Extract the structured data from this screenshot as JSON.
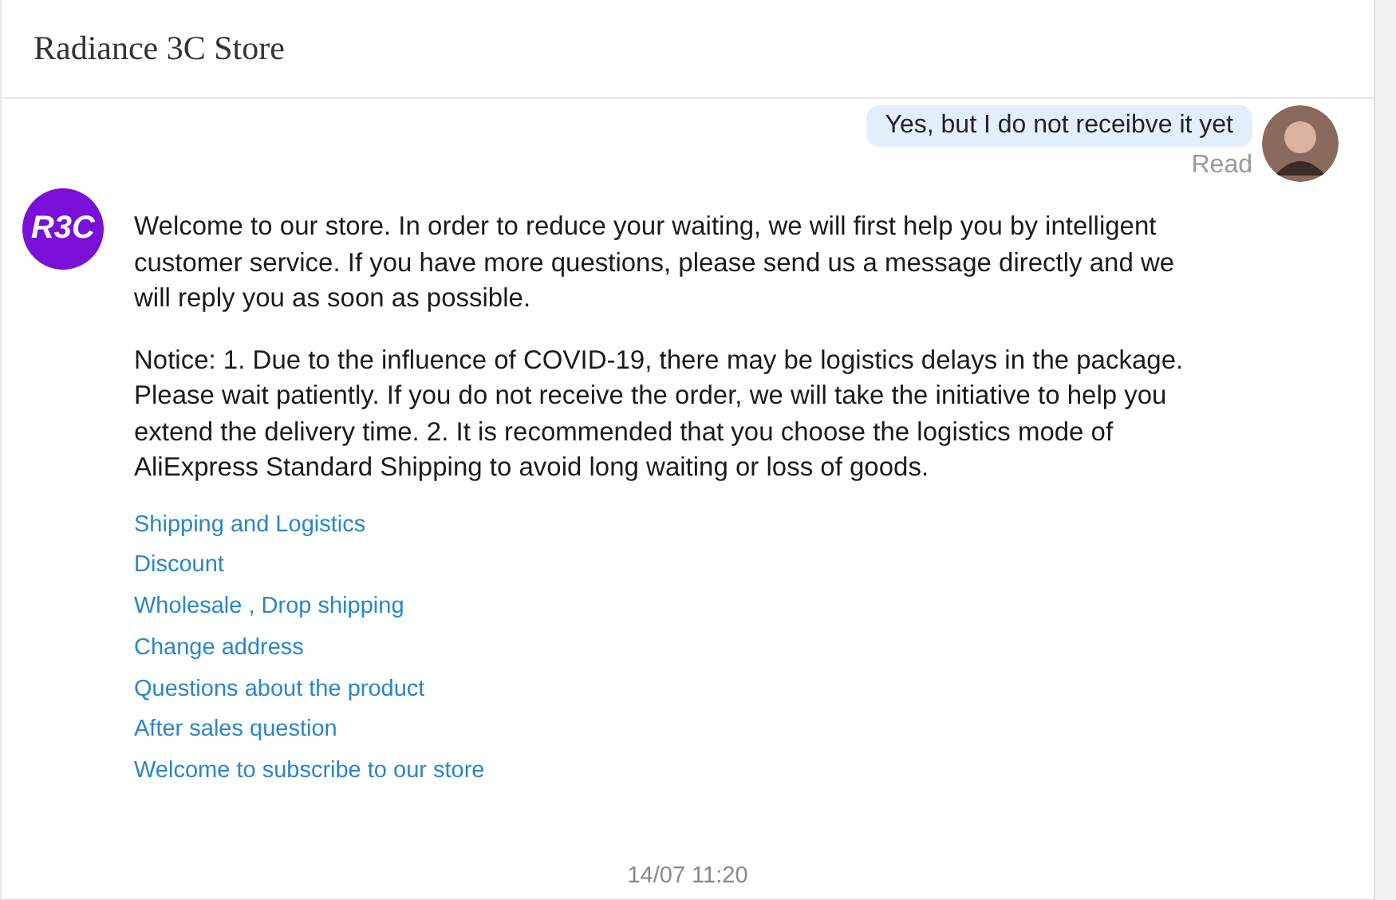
{
  "header": {
    "title": "Radiance 3C Store"
  },
  "outgoing": {
    "text": "Yes, but I do not receibve it yet",
    "status": "Read"
  },
  "incoming": {
    "avatar": "R3C",
    "paragraphs": [
      "Welcome to our store. In order to reduce your waiting, we will first help you by intelligent customer service. If you have more questions, please send us a message directly and we will reply you as soon as possible.",
      "Notice: 1. Due to the influence of COVID-19, there may be logistics delays in the package. Please wait patiently. If you do not receive the order, we will take the initiative to help you extend the delivery time. 2. It is recommended that you choose the logistics mode of AliExpress Standard Shipping to avoid long waiting or loss of goods."
    ],
    "links": [
      "Shipping and Logistics",
      "Discount",
      "Wholesale , Drop shipping",
      "Change address",
      "Questions about the product",
      "After sales question",
      "Welcome to subscribe to our store"
    ]
  },
  "timestamp": "14/07 11:20"
}
